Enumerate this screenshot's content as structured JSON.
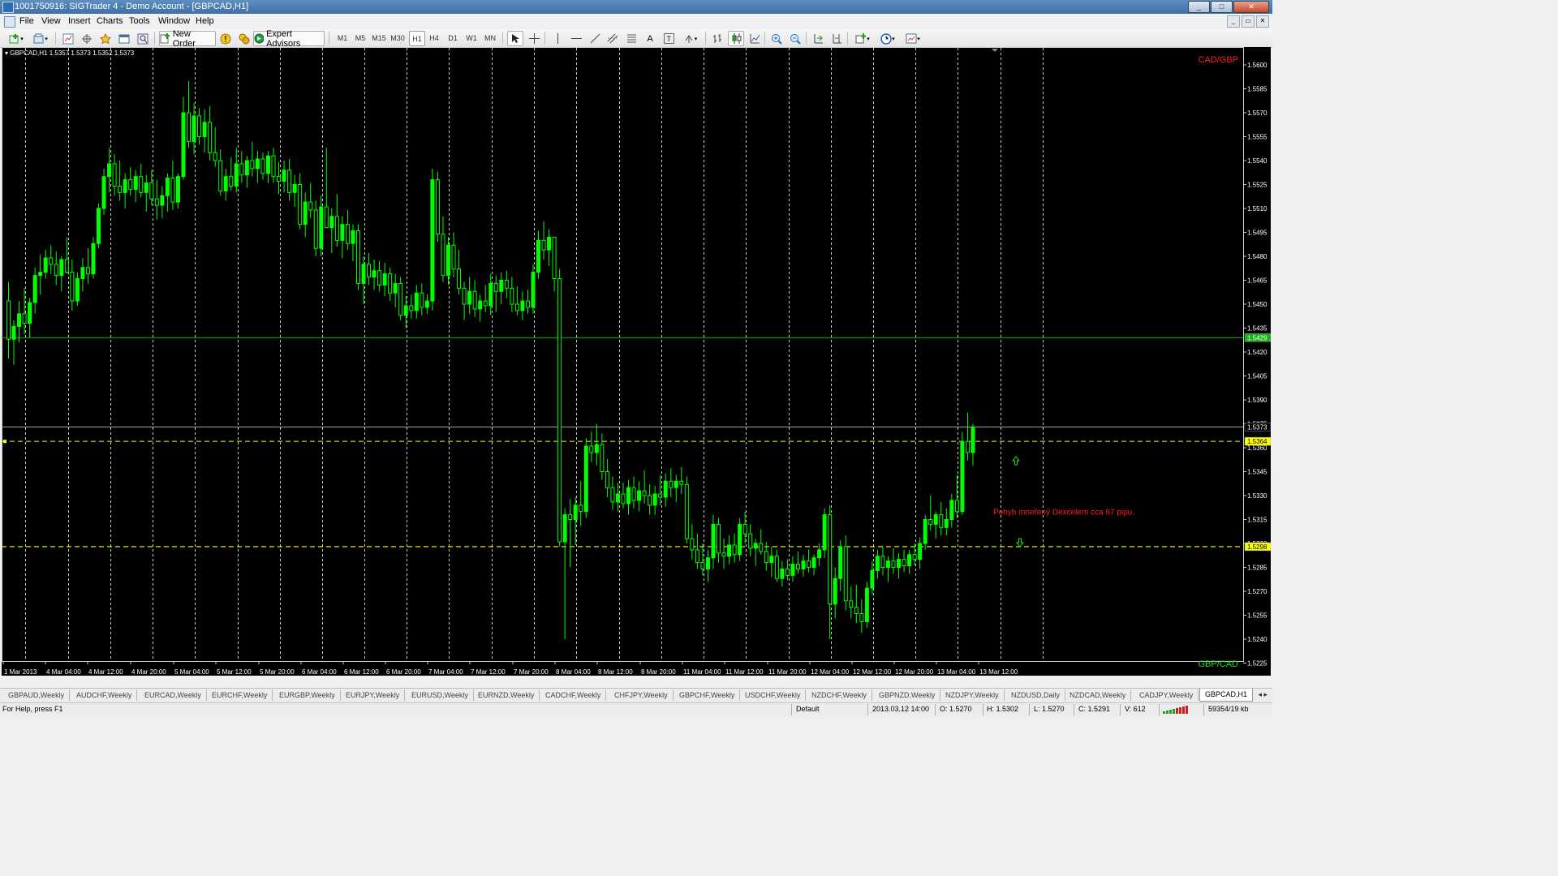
{
  "window": {
    "title": "1001750916: SIGTrader 4 - Demo Account - [GBPCAD,H1]",
    "buttons": [
      "_",
      "□",
      "✕"
    ]
  },
  "menu": {
    "items": [
      "File",
      "View",
      "Insert",
      "Charts",
      "Tools",
      "Window",
      "Help"
    ]
  },
  "toolbar": {
    "new_order": "New Order",
    "expert_advisors": "Expert Advisors",
    "timeframes": [
      "M1",
      "M5",
      "M15",
      "M30",
      "H1",
      "H4",
      "D1",
      "W1",
      "MN"
    ],
    "selected_timeframe": "H1",
    "text_tool": "A",
    "label_tool": "T"
  },
  "chart": {
    "symbol_info": "GBPCAD,H1  1.5357 1.5373 1.5352 1.5373",
    "top_right_label": "CAD/GBP",
    "bottom_right_label": "GBP/CAD",
    "annotation": "Pohyb mneřený Dexcelem cca 67 pipu.",
    "colors": {
      "background": "#000000",
      "bull": "#00ff00",
      "bear": "#000000",
      "candle_outline": "#00ff00",
      "grid": "#cfcfcf",
      "bid_line": "#00c000",
      "ask_line": "#9da9b8",
      "hline": "#ffff00",
      "annotation": "#ff2020"
    },
    "price_labels": [
      "1.5600",
      "1.5585",
      "1.5570",
      "1.5555",
      "1.5540",
      "1.5525",
      "1.5510",
      "1.5495",
      "1.5480",
      "1.5465",
      "1.5450",
      "1.5435",
      "1.5420",
      "1.5405",
      "1.5390",
      "1.5375",
      "1.5360",
      "1.5345",
      "1.5330",
      "1.5315",
      "1.5300",
      "1.5285",
      "1.5270",
      "1.5255",
      "1.5240",
      "1.5225"
    ],
    "marker_green": "1.5429",
    "marker_ask": "1.5373",
    "marker_yellow_1": "1.5364",
    "marker_yellow_2": "1.5298",
    "time_labels": [
      "1 Mar 2013",
      "4 Mar 04:00",
      "4 Mar 12:00",
      "4 Mar 20:00",
      "5 Mar 04:00",
      "5 Mar 12:00",
      "5 Mar 20:00",
      "6 Mar 04:00",
      "6 Mar 12:00",
      "6 Mar 20:00",
      "7 Mar 04:00",
      "7 Mar 12:00",
      "7 Mar 20:00",
      "8 Mar 04:00",
      "8 Mar 12:00",
      "8 Mar 20:00",
      "11 Mar 04:00",
      "11 Mar 12:00",
      "11 Mar 20:00",
      "12 Mar 04:00",
      "12 Mar 12:00",
      "12 Mar 20:00",
      "13 Mar 04:00",
      "13 Mar 12:00"
    ]
  },
  "chart_data": {
    "type": "candlestick",
    "symbol": "GBPCAD",
    "timeframe": "H1",
    "ylim": [
      1.5218,
      1.5612
    ],
    "grid": "vertical dashed every 8 bars",
    "hlines": [
      1.5429,
      1.5373,
      1.5364,
      1.5298
    ],
    "candles": [
      [
        1.5452,
        1.5464,
        1.5416,
        1.5428
      ],
      [
        1.5428,
        1.544,
        1.5412,
        1.5436
      ],
      [
        1.5436,
        1.5452,
        1.5426,
        1.5444
      ],
      [
        1.5444,
        1.546,
        1.5431,
        1.5438
      ],
      [
        1.5438,
        1.5454,
        1.5429,
        1.5451
      ],
      [
        1.5451,
        1.5473,
        1.5444,
        1.5468
      ],
      [
        1.5468,
        1.5481,
        1.5456,
        1.547
      ],
      [
        1.547,
        1.5484,
        1.5466,
        1.5479
      ],
      [
        1.5479,
        1.5487,
        1.5469,
        1.5475
      ],
      [
        1.5475,
        1.5483,
        1.5462,
        1.5468
      ],
      [
        1.5468,
        1.548,
        1.5458,
        1.5478
      ],
      [
        1.5478,
        1.5492,
        1.5469,
        1.547
      ],
      [
        1.547,
        1.5478,
        1.5446,
        1.5452
      ],
      [
        1.5452,
        1.547,
        1.5449,
        1.5466
      ],
      [
        1.5466,
        1.5479,
        1.5458,
        1.5473
      ],
      [
        1.5473,
        1.5485,
        1.5463,
        1.5469
      ],
      [
        1.5469,
        1.5492,
        1.5466,
        1.5488
      ],
      [
        1.5488,
        1.5513,
        1.5485,
        1.551
      ],
      [
        1.551,
        1.5535,
        1.5506,
        1.553
      ],
      [
        1.553,
        1.5548,
        1.552,
        1.5538
      ],
      [
        1.5538,
        1.5544,
        1.5518,
        1.5524
      ],
      [
        1.5524,
        1.554,
        1.5515,
        1.552
      ],
      [
        1.552,
        1.5532,
        1.551,
        1.5528
      ],
      [
        1.5528,
        1.5536,
        1.5518,
        1.5522
      ],
      [
        1.5522,
        1.5534,
        1.5514,
        1.553
      ],
      [
        1.553,
        1.5538,
        1.5517,
        1.552
      ],
      [
        1.552,
        1.5531,
        1.5508,
        1.5526
      ],
      [
        1.5526,
        1.5534,
        1.5512,
        1.5516
      ],
      [
        1.5516,
        1.5528,
        1.5503,
        1.5512
      ],
      [
        1.5512,
        1.5524,
        1.5504,
        1.5518
      ],
      [
        1.5518,
        1.5532,
        1.5508,
        1.5529
      ],
      [
        1.5529,
        1.554,
        1.5509,
        1.5514
      ],
      [
        1.5514,
        1.5532,
        1.551,
        1.553
      ],
      [
        1.553,
        1.558,
        1.5528,
        1.557
      ],
      [
        1.557,
        1.559,
        1.5548,
        1.5552
      ],
      [
        1.5552,
        1.5576,
        1.5544,
        1.5568
      ],
      [
        1.5568,
        1.5573,
        1.555,
        1.5555
      ],
      [
        1.5555,
        1.5572,
        1.5545,
        1.5564
      ],
      [
        1.5564,
        1.5574,
        1.554,
        1.5545
      ],
      [
        1.5545,
        1.5561,
        1.5536,
        1.554
      ],
      [
        1.554,
        1.5547,
        1.5518,
        1.5521
      ],
      [
        1.5521,
        1.5535,
        1.5515,
        1.553
      ],
      [
        1.553,
        1.5542,
        1.5521,
        1.5524
      ],
      [
        1.5524,
        1.5548,
        1.552,
        1.5538
      ],
      [
        1.5538,
        1.5546,
        1.5526,
        1.5531
      ],
      [
        1.5531,
        1.5543,
        1.5523,
        1.554
      ],
      [
        1.554,
        1.5552,
        1.553,
        1.5535
      ],
      [
        1.5535,
        1.5546,
        1.5526,
        1.5541
      ],
      [
        1.5541,
        1.5545,
        1.5528,
        1.5532
      ],
      [
        1.5532,
        1.5546,
        1.5526,
        1.5543
      ],
      [
        1.5543,
        1.5548,
        1.5526,
        1.553
      ],
      [
        1.553,
        1.5539,
        1.5519,
        1.5527
      ],
      [
        1.5527,
        1.554,
        1.552,
        1.5534
      ],
      [
        1.5534,
        1.5541,
        1.5515,
        1.552
      ],
      [
        1.552,
        1.5531,
        1.5511,
        1.5525
      ],
      [
        1.5525,
        1.5532,
        1.5497,
        1.55
      ],
      [
        1.55,
        1.552,
        1.5492,
        1.5514
      ],
      [
        1.5514,
        1.5526,
        1.5504,
        1.5509
      ],
      [
        1.5509,
        1.5515,
        1.548,
        1.5485
      ],
      [
        1.5485,
        1.5518,
        1.548,
        1.5511
      ],
      [
        1.5511,
        1.5548,
        1.5504,
        1.5498
      ],
      [
        1.5498,
        1.551,
        1.5482,
        1.5505
      ],
      [
        1.5505,
        1.5519,
        1.5486,
        1.549
      ],
      [
        1.549,
        1.5505,
        1.5479,
        1.55
      ],
      [
        1.55,
        1.5509,
        1.5484,
        1.5488
      ],
      [
        1.5488,
        1.55,
        1.5477,
        1.5496
      ],
      [
        1.5496,
        1.55,
        1.5459,
        1.5463
      ],
      [
        1.5463,
        1.548,
        1.545,
        1.5475
      ],
      [
        1.5475,
        1.5482,
        1.5462,
        1.5467
      ],
      [
        1.5467,
        1.5478,
        1.5459,
        1.5471
      ],
      [
        1.5471,
        1.5477,
        1.5458,
        1.5462
      ],
      [
        1.5462,
        1.5476,
        1.5455,
        1.5469
      ],
      [
        1.5469,
        1.5473,
        1.5452,
        1.5457
      ],
      [
        1.5457,
        1.5469,
        1.5448,
        1.5463
      ],
      [
        1.5463,
        1.5467,
        1.544,
        1.5443
      ],
      [
        1.5443,
        1.5455,
        1.5435,
        1.5449
      ],
      [
        1.5449,
        1.5456,
        1.5441,
        1.5446
      ],
      [
        1.5446,
        1.5462,
        1.5441,
        1.5457
      ],
      [
        1.5457,
        1.5463,
        1.5443,
        1.5448
      ],
      [
        1.5448,
        1.5456,
        1.5444,
        1.5452
      ],
      [
        1.5452,
        1.5535,
        1.5446,
        1.5528
      ],
      [
        1.5528,
        1.5533,
        1.5489,
        1.5494
      ],
      [
        1.5494,
        1.5505,
        1.5464,
        1.5468
      ],
      [
        1.5468,
        1.5492,
        1.5462,
        1.5487
      ],
      [
        1.5487,
        1.5495,
        1.5467,
        1.5472
      ],
      [
        1.5472,
        1.5484,
        1.5456,
        1.546
      ],
      [
        1.546,
        1.5464,
        1.544,
        1.545
      ],
      [
        1.545,
        1.5467,
        1.5444,
        1.5458
      ],
      [
        1.5458,
        1.5465,
        1.5442,
        1.5447
      ],
      [
        1.5447,
        1.5456,
        1.5439,
        1.5452
      ],
      [
        1.5452,
        1.5462,
        1.5445,
        1.5449
      ],
      [
        1.5449,
        1.5469,
        1.5443,
        1.5463
      ],
      [
        1.5463,
        1.5468,
        1.5445,
        1.5458
      ],
      [
        1.5458,
        1.547,
        1.545,
        1.5465
      ],
      [
        1.5465,
        1.5471,
        1.5454,
        1.546
      ],
      [
        1.546,
        1.5467,
        1.5445,
        1.545
      ],
      [
        1.545,
        1.5461,
        1.5443,
        1.5446
      ],
      [
        1.5446,
        1.5458,
        1.544,
        1.5452
      ],
      [
        1.5452,
        1.5459,
        1.5444,
        1.5448
      ],
      [
        1.5448,
        1.5475,
        1.5444,
        1.547
      ],
      [
        1.547,
        1.5496,
        1.5466,
        1.549
      ],
      [
        1.549,
        1.5502,
        1.5478,
        1.5484
      ],
      [
        1.5484,
        1.5497,
        1.5474,
        1.5492
      ],
      [
        1.5492,
        1.5484,
        1.5458,
        1.5466
      ],
      [
        1.5466,
        1.5472,
        1.5298,
        1.5301
      ],
      [
        1.5301,
        1.5322,
        1.524,
        1.5318
      ],
      [
        1.5318,
        1.5328,
        1.5285,
        1.5315
      ],
      [
        1.5315,
        1.5329,
        1.5299,
        1.5324
      ],
      [
        1.5324,
        1.5339,
        1.5311,
        1.532
      ],
      [
        1.532,
        1.5366,
        1.5316,
        1.5361
      ],
      [
        1.5361,
        1.537,
        1.5351,
        1.5357
      ],
      [
        1.5357,
        1.5375,
        1.5349,
        1.5362
      ],
      [
        1.5362,
        1.5369,
        1.534,
        1.5345
      ],
      [
        1.5345,
        1.5353,
        1.5329,
        1.5335
      ],
      [
        1.5335,
        1.5342,
        1.5321,
        1.5326
      ],
      [
        1.5326,
        1.5338,
        1.532,
        1.5331
      ],
      [
        1.5331,
        1.5338,
        1.5322,
        1.5325
      ],
      [
        1.5325,
        1.534,
        1.5318,
        1.5335
      ],
      [
        1.5335,
        1.5342,
        1.5322,
        1.5327
      ],
      [
        1.5327,
        1.5339,
        1.532,
        1.5333
      ],
      [
        1.5333,
        1.5346,
        1.5325,
        1.533
      ],
      [
        1.533,
        1.5337,
        1.5318,
        1.5324
      ],
      [
        1.5324,
        1.5336,
        1.5318,
        1.5331
      ],
      [
        1.5331,
        1.5343,
        1.5324,
        1.5329
      ],
      [
        1.5329,
        1.5344,
        1.5323,
        1.5339
      ],
      [
        1.5339,
        1.5347,
        1.5329,
        1.5335
      ],
      [
        1.5335,
        1.5343,
        1.5326,
        1.5339
      ],
      [
        1.5339,
        1.5348,
        1.5331,
        1.5337
      ],
      [
        1.5337,
        1.5342,
        1.53,
        1.5303
      ],
      [
        1.5303,
        1.5312,
        1.529,
        1.5296
      ],
      [
        1.5296,
        1.5306,
        1.5284,
        1.5288
      ],
      [
        1.5288,
        1.53,
        1.528,
        1.5284
      ],
      [
        1.5284,
        1.5296,
        1.5276,
        1.5291
      ],
      [
        1.5291,
        1.5318,
        1.5284,
        1.5312
      ],
      [
        1.5312,
        1.5316,
        1.5288,
        1.5294
      ],
      [
        1.5294,
        1.5303,
        1.5284,
        1.5292
      ],
      [
        1.5292,
        1.5305,
        1.5287,
        1.5299
      ],
      [
        1.5299,
        1.5306,
        1.5288,
        1.5293
      ],
      [
        1.5293,
        1.5316,
        1.5289,
        1.5312
      ],
      [
        1.5312,
        1.532,
        1.53,
        1.5306
      ],
      [
        1.5306,
        1.5312,
        1.5292,
        1.5297
      ],
      [
        1.5297,
        1.5303,
        1.5286,
        1.53
      ],
      [
        1.53,
        1.5309,
        1.5293,
        1.5295
      ],
      [
        1.5295,
        1.5301,
        1.5283,
        1.5288
      ],
      [
        1.5288,
        1.5298,
        1.5279,
        1.5292
      ],
      [
        1.5292,
        1.5296,
        1.5276,
        1.5278
      ],
      [
        1.5278,
        1.5289,
        1.5273,
        1.5284
      ],
      [
        1.5284,
        1.529,
        1.5277,
        1.528
      ],
      [
        1.528,
        1.5292,
        1.5276,
        1.5287
      ],
      [
        1.5287,
        1.5295,
        1.5281,
        1.5284
      ],
      [
        1.5284,
        1.5293,
        1.5279,
        1.5289
      ],
      [
        1.5289,
        1.5296,
        1.5282,
        1.5285
      ],
      [
        1.5285,
        1.5293,
        1.528,
        1.5291
      ],
      [
        1.5291,
        1.53,
        1.5286,
        1.5296
      ],
      [
        1.5296,
        1.5322,
        1.5291,
        1.5318
      ],
      [
        1.5318,
        1.5324,
        1.524,
        1.5262
      ],
      [
        1.5262,
        1.5285,
        1.5253,
        1.5278
      ],
      [
        1.5278,
        1.5302,
        1.527,
        1.5298
      ],
      [
        1.5298,
        1.5305,
        1.5258,
        1.5264
      ],
      [
        1.5264,
        1.5273,
        1.5253,
        1.526
      ],
      [
        1.526,
        1.5274,
        1.525,
        1.5256
      ],
      [
        1.5256,
        1.5265,
        1.5244,
        1.5251
      ],
      [
        1.5251,
        1.5276,
        1.5247,
        1.5272
      ],
      [
        1.5272,
        1.5289,
        1.5268,
        1.5283
      ],
      [
        1.5283,
        1.5296,
        1.5278,
        1.5292
      ],
      [
        1.5292,
        1.5298,
        1.528,
        1.5285
      ],
      [
        1.5285,
        1.5292,
        1.5276,
        1.5289
      ],
      [
        1.5289,
        1.5297,
        1.5281,
        1.5285
      ],
      [
        1.5285,
        1.5294,
        1.5278,
        1.529
      ],
      [
        1.529,
        1.5296,
        1.5282,
        1.5286
      ],
      [
        1.5286,
        1.5296,
        1.5281,
        1.5293
      ],
      [
        1.5293,
        1.53,
        1.5286,
        1.529
      ],
      [
        1.529,
        1.5304,
        1.5284,
        1.53
      ],
      [
        1.53,
        1.5318,
        1.5296,
        1.5315
      ],
      [
        1.5315,
        1.533,
        1.5308,
        1.5312
      ],
      [
        1.5312,
        1.532,
        1.5303,
        1.5318
      ],
      [
        1.5318,
        1.5326,
        1.5305,
        1.531
      ],
      [
        1.531,
        1.5322,
        1.5305,
        1.5315
      ],
      [
        1.5315,
        1.5331,
        1.531,
        1.5327
      ],
      [
        1.5327,
        1.5343,
        1.5316,
        1.532
      ],
      [
        1.532,
        1.537,
        1.5318,
        1.5364
      ],
      [
        1.5364,
        1.5382,
        1.5352,
        1.5357
      ],
      [
        1.5357,
        1.5375,
        1.5349,
        1.5373
      ]
    ]
  },
  "tabs": [
    "GBPAUD,Weekly",
    "AUDCHF,Weekly",
    "EURCAD,Weekly",
    "EURCHF,Weekly",
    "EURGBP,Weekly",
    "EURJPY,Weekly",
    "EURUSD,Weekly",
    "EURNZD,Weekly",
    "CADCHF,Weekly",
    "CHFJPY,Weekly",
    "GBPCHF,Weekly",
    "USDCHF,Weekly",
    "NZDCHF,Weekly",
    "GBPNZD,Weekly",
    "NZDJPY,Weekly",
    "NZDUSD,Daily",
    "NZDCAD,Weekly",
    "CADJPY,Weekly",
    "GBPCAD,H1"
  ],
  "active_tab": "GBPCAD,H1",
  "status": {
    "help": "For Help, press F1",
    "profile": "Default",
    "datetime": "2013.03.12 14:00",
    "open": "O: 1.5270",
    "high": "H: 1.5302",
    "low": "L: 1.5270",
    "close": "C: 1.5291",
    "volume": "V: 612",
    "traffic": "59354/19 kb"
  }
}
